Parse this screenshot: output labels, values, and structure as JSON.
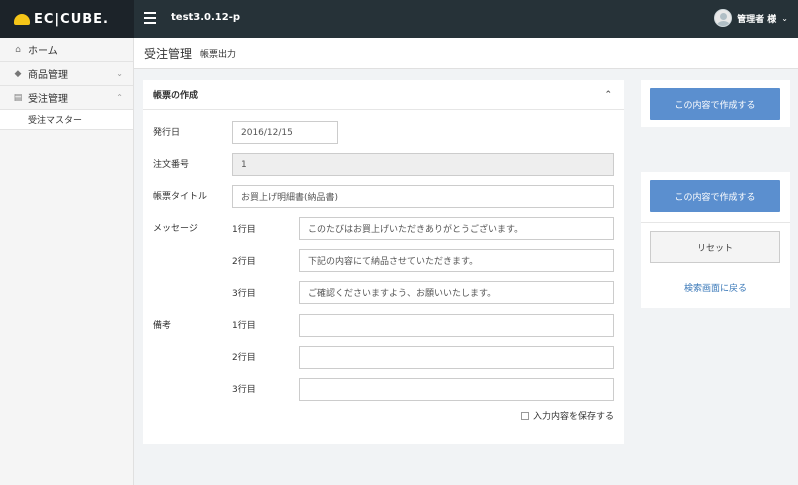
{
  "header": {
    "logo_text": "EC|CUBE.",
    "site_name": "test3.0.12-p",
    "user_name": "管理者 様",
    "menu_icon": "hamburger-icon",
    "user_icon": "avatar-icon",
    "chevron": "⌄"
  },
  "sidebar": {
    "items": [
      {
        "label": "ホーム",
        "icon": "home-icon"
      },
      {
        "label": "商品管理",
        "icon": "tag-icon",
        "arrow": "⌄"
      },
      {
        "label": "受注管理",
        "icon": "cart-icon",
        "arrow": "⌃"
      }
    ],
    "sub_items": [
      {
        "label": "受注マスター"
      }
    ]
  },
  "page": {
    "title": "受注管理",
    "subtitle": "帳票出力"
  },
  "form": {
    "card_title": "帳票の作成",
    "toggle": "⌃",
    "issue_date_label": "発行日",
    "issue_date_value": "2016/12/15",
    "order_no_label": "注文番号",
    "order_no_value": "1",
    "doc_title_label": "帳票タイトル",
    "doc_title_value": "お買上げ明細書(納品書)",
    "message_label": "メッセージ",
    "message_lines": [
      {
        "label": "1行目",
        "value": "このたびはお買上げいただきありがとうございます。"
      },
      {
        "label": "2行目",
        "value": "下記の内容にて納品させていただきます。"
      },
      {
        "label": "3行目",
        "value": "ご確認くださいますよう、お願いいたします。"
      }
    ],
    "note_label": "備考",
    "note_lines": [
      {
        "label": "1行目",
        "value": ""
      },
      {
        "label": "2行目",
        "value": ""
      },
      {
        "label": "3行目",
        "value": ""
      }
    ],
    "save_label": "入力内容を保存する"
  },
  "actions": {
    "create_label_top": "この内容で作成する",
    "create_label": "この内容で作成する",
    "reset_label": "リセット",
    "back_label": "検索画面に戻る"
  },
  "colors": {
    "header_bg": "#263238",
    "primary_button": "#5b8fcf",
    "link": "#3a78b8"
  }
}
